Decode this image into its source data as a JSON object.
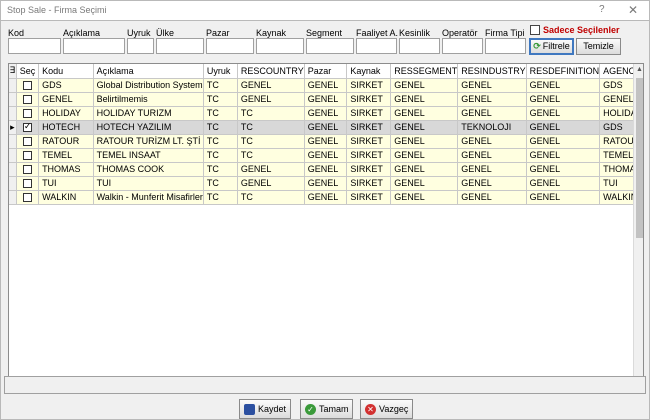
{
  "window": {
    "title": "Stop Sale - Firma Seçimi",
    "help": "?",
    "close": "✕"
  },
  "filters": [
    {
      "label": "Kod"
    },
    {
      "label": "Açıklama"
    },
    {
      "label": "Uyruk"
    },
    {
      "label": "Ülke"
    },
    {
      "label": "Pazar"
    },
    {
      "label": "Kaynak"
    },
    {
      "label": "Segment"
    },
    {
      "label": "Faaliyet A."
    },
    {
      "label": "Kesinlik"
    },
    {
      "label": "Operatör"
    },
    {
      "label": "Firma Tipi"
    }
  ],
  "only_selected_label": "Sadece Seçilenler",
  "buttons": {
    "filter": "Filtrele",
    "clear": "Temizle",
    "save": "Kaydet",
    "ok": "Tamam",
    "cancel": "Vazgeç"
  },
  "grid": {
    "columns": [
      "Seç",
      "Kodu",
      "Açıklama",
      "Uyruk",
      "RESCOUNTRY",
      "Pazar",
      "Kaynak",
      "RESSEGMENT",
      "RESINDUSTRY",
      "RESDEFINITION",
      "AGENCY"
    ],
    "rows": [
      {
        "checked": false,
        "current": false,
        "cells": [
          "GDS",
          "Global Distribution System",
          "TC",
          "GENEL",
          "GENEL",
          "SIRKET",
          "GENEL",
          "GENEL",
          "GENEL",
          "GDS"
        ]
      },
      {
        "checked": false,
        "current": false,
        "cells": [
          "GENEL",
          "Belirtilmemis",
          "TC",
          "GENEL",
          "GENEL",
          "SIRKET",
          "GENEL",
          "GENEL",
          "GENEL",
          "GENEL"
        ]
      },
      {
        "checked": false,
        "current": false,
        "cells": [
          "HOLIDAY",
          "HOLIDAY TURIZM",
          "TC",
          "TC",
          "GENEL",
          "SIRKET",
          "GENEL",
          "GENEL",
          "GENEL",
          "HOLIDAY"
        ]
      },
      {
        "checked": true,
        "current": true,
        "cells": [
          "HOTECH",
          "HOTECH YAZILIM",
          "TC",
          "TC",
          "GENEL",
          "SIRKET",
          "GENEL",
          "TEKNOLOJI",
          "GENEL",
          "GDS"
        ]
      },
      {
        "checked": false,
        "current": false,
        "cells": [
          "RATOUR",
          "RATOUR TURİZM LT. ŞTİ",
          "TC",
          "TC",
          "GENEL",
          "SIRKET",
          "GENEL",
          "GENEL",
          "GENEL",
          "RATOUR"
        ]
      },
      {
        "checked": false,
        "current": false,
        "cells": [
          "TEMEL",
          "TEMEL INSAAT",
          "TC",
          "TC",
          "GENEL",
          "SIRKET",
          "GENEL",
          "GENEL",
          "GENEL",
          "TEMEL"
        ]
      },
      {
        "checked": false,
        "current": false,
        "cells": [
          "THOMAS",
          "THOMAS COOK",
          "TC",
          "GENEL",
          "GENEL",
          "SIRKET",
          "GENEL",
          "GENEL",
          "GENEL",
          "THOMAS"
        ]
      },
      {
        "checked": false,
        "current": false,
        "cells": [
          "TUI",
          "TUI",
          "TC",
          "GENEL",
          "GENEL",
          "SIRKET",
          "GENEL",
          "GENEL",
          "GENEL",
          "TUI"
        ]
      },
      {
        "checked": false,
        "current": false,
        "cells": [
          "WALKIN",
          "Walkin - Munferit Misafirler",
          "TC",
          "TC",
          "GENEL",
          "SIRKET",
          "GENEL",
          "GENEL",
          "GENEL",
          "WALKIN"
        ]
      }
    ]
  }
}
